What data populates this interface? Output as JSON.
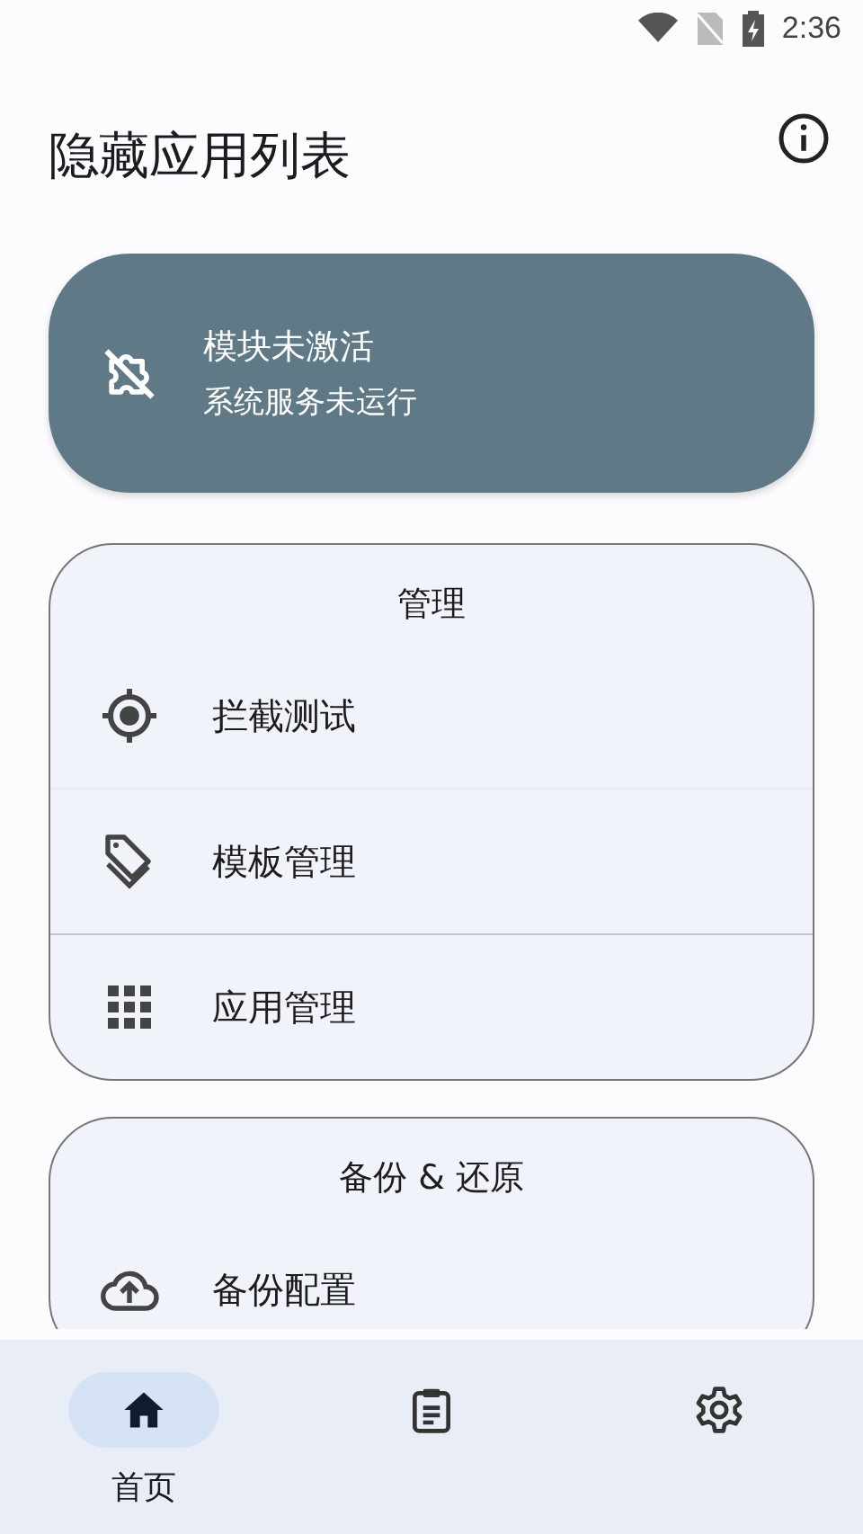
{
  "status_bar": {
    "time": "2:36"
  },
  "app_bar": {
    "title": "隐藏应用列表"
  },
  "module_status": {
    "active": false,
    "title": "模块未激活",
    "subtitle": "系统服务未运行"
  },
  "sections": [
    {
      "title": "管理",
      "items": [
        {
          "kind": "target",
          "label": "拦截测试"
        },
        {
          "kind": "tags",
          "label": "模板管理"
        },
        {
          "kind": "apps",
          "label": "应用管理"
        }
      ]
    },
    {
      "title": "备份 & 还原",
      "items": [
        {
          "kind": "backup",
          "label": "备份配置"
        }
      ]
    }
  ],
  "bottom_nav": [
    {
      "kind": "home",
      "label": "首页",
      "selected": true
    },
    {
      "kind": "logs",
      "selected": false
    },
    {
      "kind": "settings",
      "selected": false
    }
  ]
}
